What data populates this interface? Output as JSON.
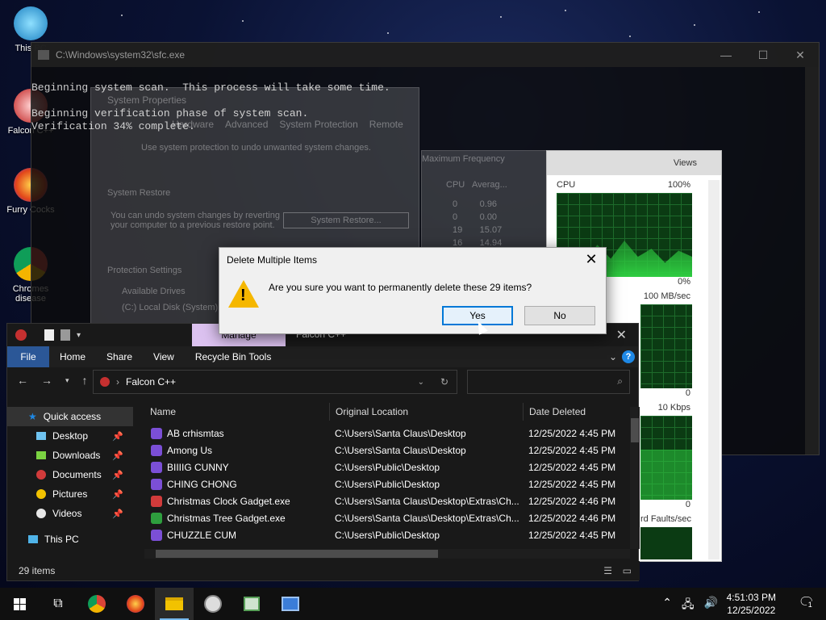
{
  "desktop": {
    "icons": [
      {
        "label": "This PC",
        "icon": "computer-icon"
      },
      {
        "label": "Falcon C++",
        "icon": "recycle-bin-icon"
      },
      {
        "label": "Furry Cocks",
        "icon": "firefox-icon"
      },
      {
        "label": "Chromes disease",
        "icon": "chrome-icon"
      }
    ]
  },
  "cmd": {
    "title": "C:\\Windows\\system32\\sfc.exe",
    "line1": "Beginning system scan.  This process will take some time.",
    "line2": "Beginning verification phase of system scan.",
    "line3": "Verification 34% complete."
  },
  "system_properties": {
    "title": "System Properties",
    "tabs": [
      "Hardware",
      "Advanced",
      "System Protection",
      "Remote"
    ],
    "desc": "Use system protection to undo unwanted system changes.",
    "restore_heading": "System Restore",
    "restore_text": "You can undo system changes by reverting your computer to a previous restore point.",
    "restore_button": "System Restore...",
    "protection_heading": "Protection Settings",
    "drives_header": "Available Drives",
    "drive": "(C:) Local Disk (System)"
  },
  "task_manager": {
    "col_freq": "Maximum Frequency",
    "col_cpu": "CPU",
    "col_avg": "Averag...",
    "rows": [
      [
        "0",
        "0.96"
      ],
      [
        "0",
        "0.00"
      ],
      [
        "19",
        "15.07"
      ],
      [
        "16",
        "14.94"
      ]
    ],
    "views": "Views",
    "cpu_label": "CPU",
    "cpu_max": "100%",
    "cpu_min": "0%",
    "disk_max": "100 MB/sec",
    "disk_min": "0",
    "net_max": "10 Kbps",
    "net_min": "0",
    "faults_label": "rd Faults/sec"
  },
  "dialog": {
    "title": "Delete Multiple Items",
    "message": "Are you sure you want to permanently delete these 29 items?",
    "yes": "Yes",
    "no": "No"
  },
  "explorer": {
    "context_tab": "Manage",
    "window_title": "Falcon C++",
    "ribbon": [
      "File",
      "Home",
      "Share",
      "View",
      "Recycle Bin Tools"
    ],
    "address": "Falcon C++",
    "nav": [
      {
        "label": "Quick access",
        "icon": "star-icon",
        "pinned": false
      },
      {
        "label": "Desktop",
        "icon": "desktop-icon",
        "pinned": true
      },
      {
        "label": "Downloads",
        "icon": "downloads-icon",
        "pinned": true
      },
      {
        "label": "Documents",
        "icon": "documents-icon",
        "pinned": true
      },
      {
        "label": "Pictures",
        "icon": "pictures-icon",
        "pinned": true
      },
      {
        "label": "Videos",
        "icon": "videos-icon",
        "pinned": true
      },
      {
        "label": "This PC",
        "icon": "computer-icon",
        "pinned": false
      }
    ],
    "columns": [
      "Name",
      "Original Location",
      "Date Deleted"
    ],
    "rows": [
      {
        "name": "AB crhismtas",
        "location": "C:\\Users\\Santa Claus\\Desktop",
        "date": "12/25/2022 4:45 PM",
        "icon": "purple"
      },
      {
        "name": "Among Us",
        "location": "C:\\Users\\Santa Claus\\Desktop",
        "date": "12/25/2022 4:45 PM",
        "icon": "purple"
      },
      {
        "name": "BIIIIG CUNNY",
        "location": "C:\\Users\\Public\\Desktop",
        "date": "12/25/2022 4:45 PM",
        "icon": "purple"
      },
      {
        "name": "CHING CHONG",
        "location": "C:\\Users\\Public\\Desktop",
        "date": "12/25/2022 4:45 PM",
        "icon": "purple"
      },
      {
        "name": "Christmas Clock Gadget.exe",
        "location": "C:\\Users\\Santa Claus\\Desktop\\Extras\\Ch...",
        "date": "12/25/2022 4:46 PM",
        "icon": "red"
      },
      {
        "name": "Christmas Tree Gadget.exe",
        "location": "C:\\Users\\Santa Claus\\Desktop\\Extras\\Ch...",
        "date": "12/25/2022 4:46 PM",
        "icon": "green"
      },
      {
        "name": "CHUZZLE CUM",
        "location": "C:\\Users\\Public\\Desktop",
        "date": "12/25/2022 4:45 PM",
        "icon": "purple"
      }
    ],
    "status": "29 items"
  },
  "taskbar": {
    "time": "4:51:03 PM",
    "date": "12/25/2022",
    "notif_count": "1"
  },
  "colors": {
    "accent": "#0078d7",
    "manage_tab": "#dcc2f0",
    "warning": "#f5b700",
    "graph_green": "#2ecc40"
  }
}
